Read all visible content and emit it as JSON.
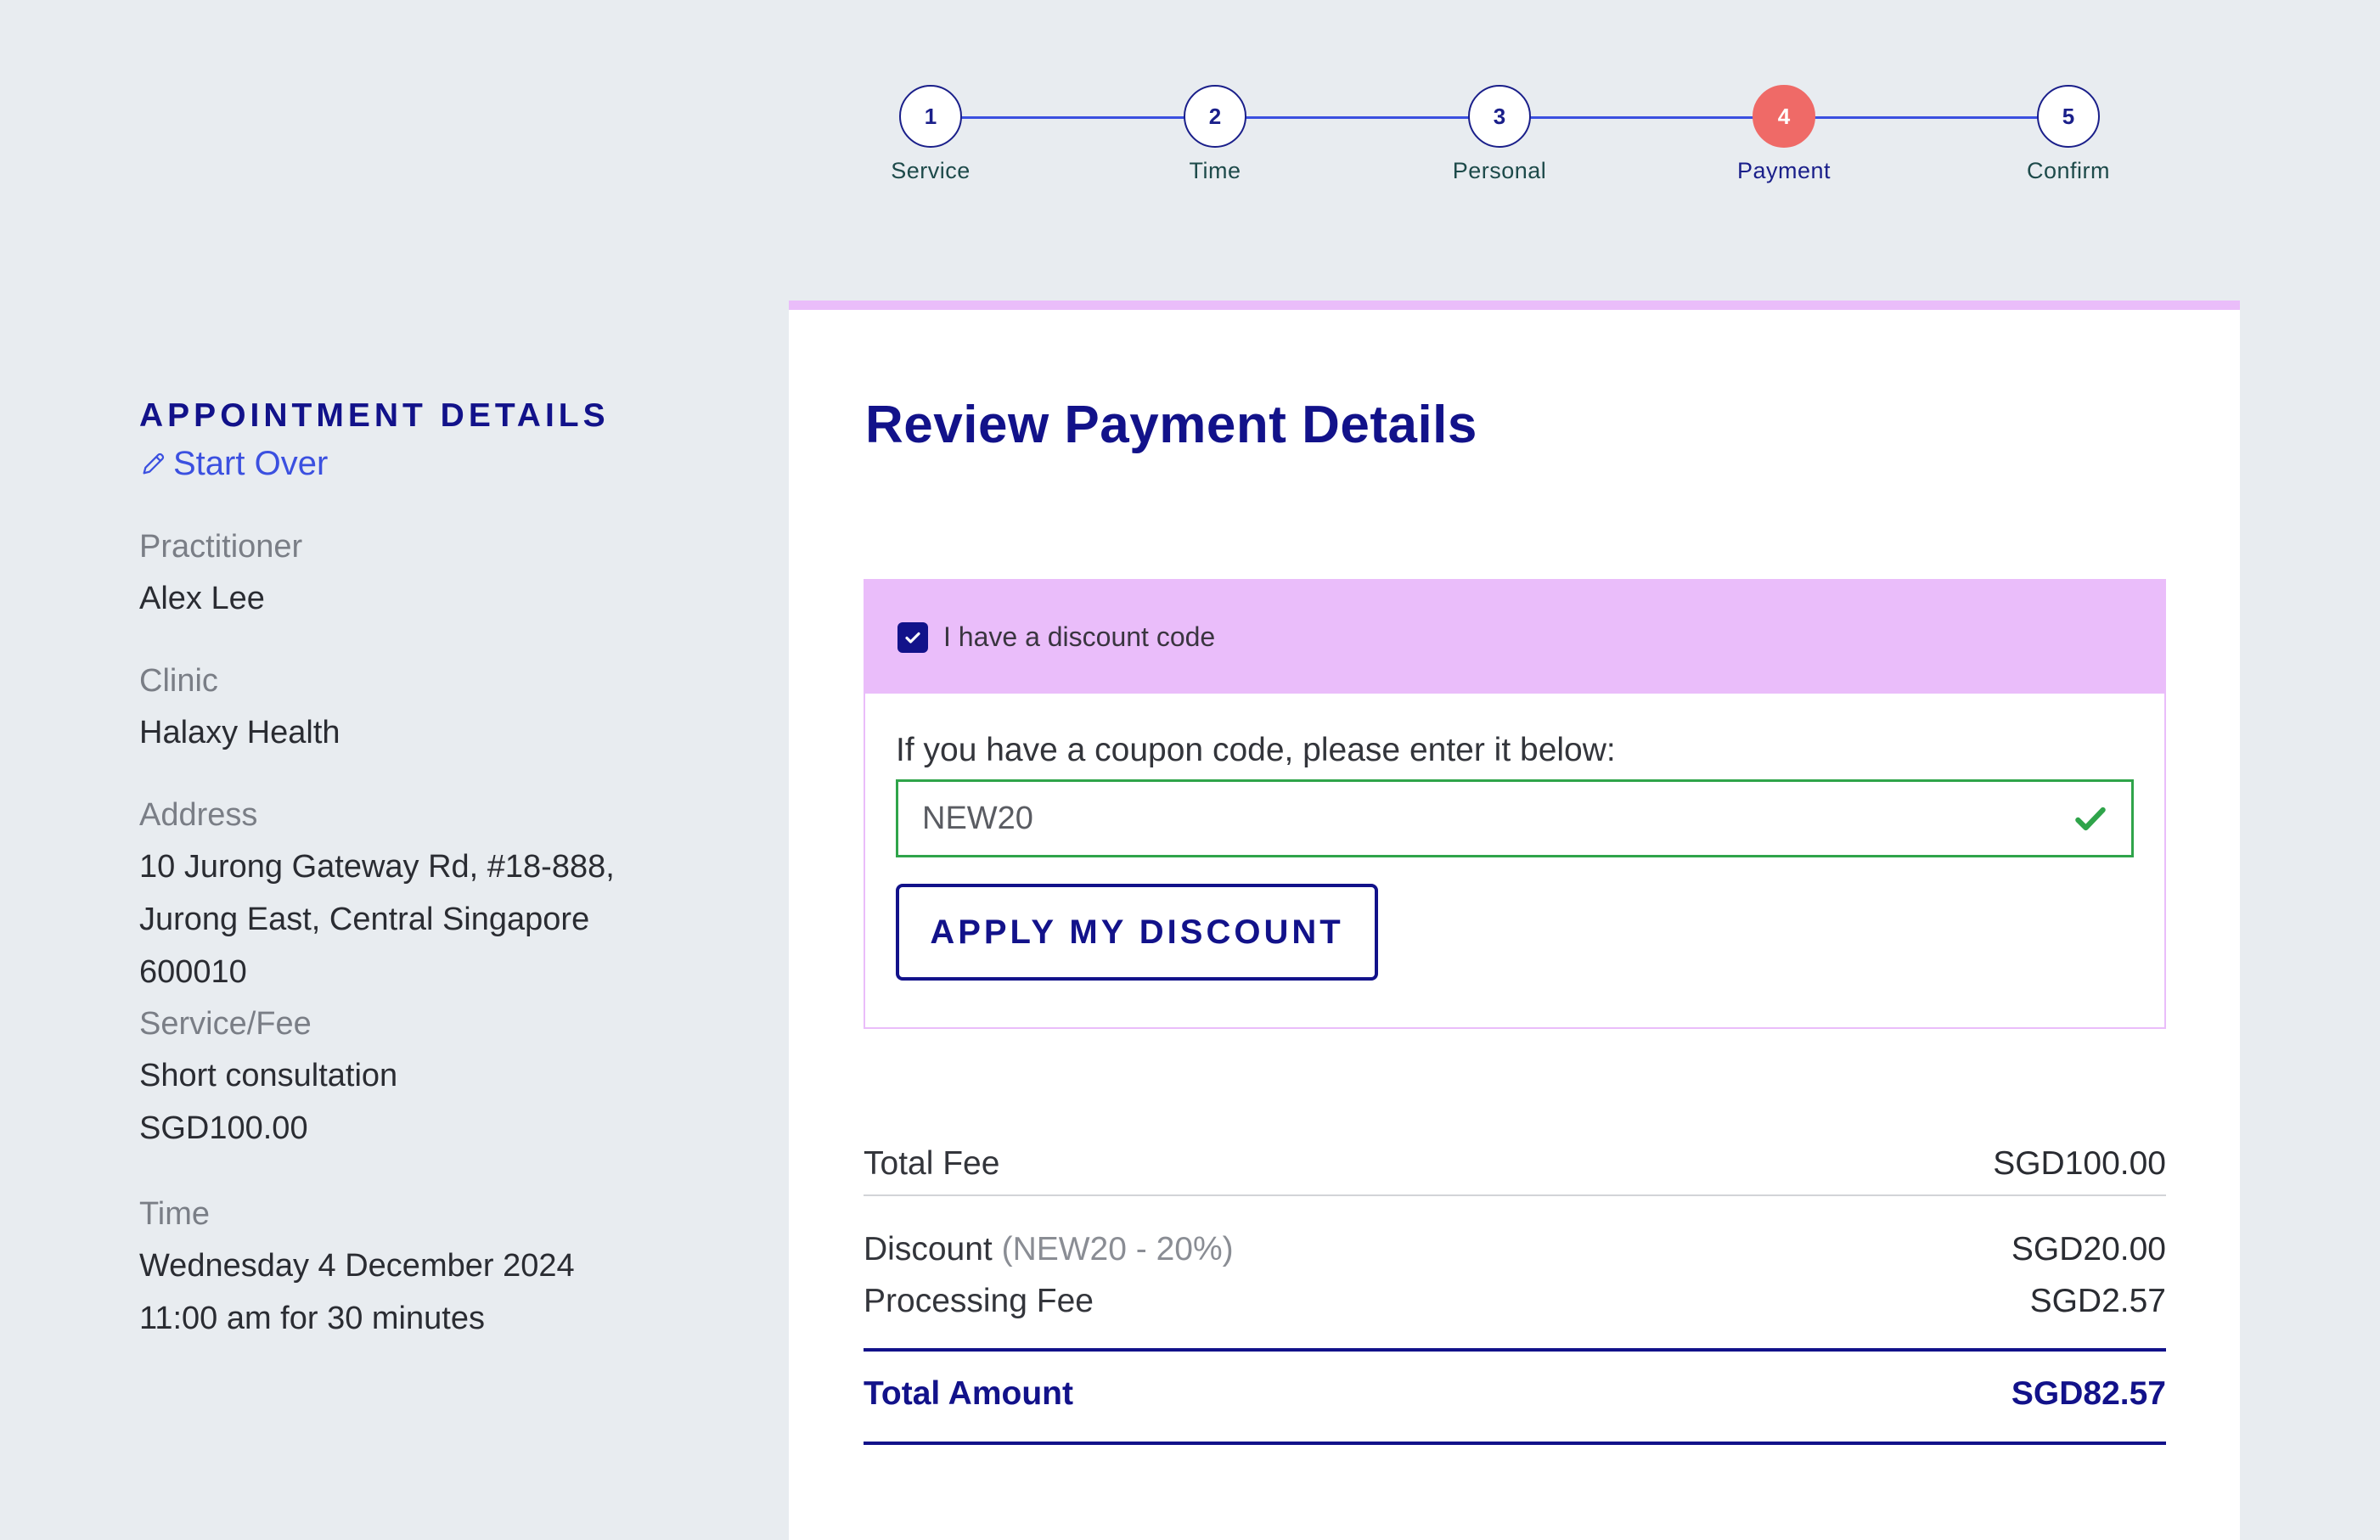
{
  "stepper": {
    "steps": [
      {
        "number": "1",
        "label": "Service"
      },
      {
        "number": "2",
        "label": "Time"
      },
      {
        "number": "3",
        "label": "Personal"
      },
      {
        "number": "4",
        "label": "Payment"
      },
      {
        "number": "5",
        "label": "Confirm"
      }
    ],
    "active_step": 4,
    "colors": {
      "line": "#3b50e0",
      "active": "#ef6a67",
      "circle_border": "#1a1f8a"
    }
  },
  "sidebar": {
    "title": "APPOINTMENT DETAILS",
    "start_over": "Start Over",
    "practitioner_label": "Practitioner",
    "practitioner_value": "Alex Lee",
    "clinic_label": "Clinic",
    "clinic_value": "Halaxy Health",
    "address_label": "Address",
    "address_lines": [
      "10 Jurong Gateway Rd, #18-888,",
      "Jurong East, Central Singapore",
      "600010"
    ],
    "service_label": "Service/Fee",
    "service_name": "Short consultation",
    "service_fee": "SGD100.00",
    "time_label": "Time",
    "time_date": "Wednesday 4 December 2024",
    "time_slot": "11:00 am for 30 minutes"
  },
  "main": {
    "title": "Review Payment Details",
    "discount": {
      "checkbox_label": "I have a discount code",
      "checked": true,
      "prompt": "If you have a coupon code, please enter it below:",
      "code_value": "NEW20",
      "apply_label": "APPLY MY DISCOUNT"
    },
    "summary": {
      "total_fee_label": "Total Fee",
      "total_fee_value": "SGD100.00",
      "discount_label": "Discount",
      "discount_detail": "(NEW20 - 20%)",
      "discount_value": "SGD20.00",
      "processing_label": "Processing Fee",
      "processing_value": "SGD2.57",
      "total_amount_label": "Total Amount",
      "total_amount_value": "SGD82.57"
    }
  },
  "colors": {
    "brand_navy": "#12128a",
    "accent_pink": "#eabdfa",
    "success_green": "#2fa44a",
    "link_blue": "#3b50e0"
  }
}
